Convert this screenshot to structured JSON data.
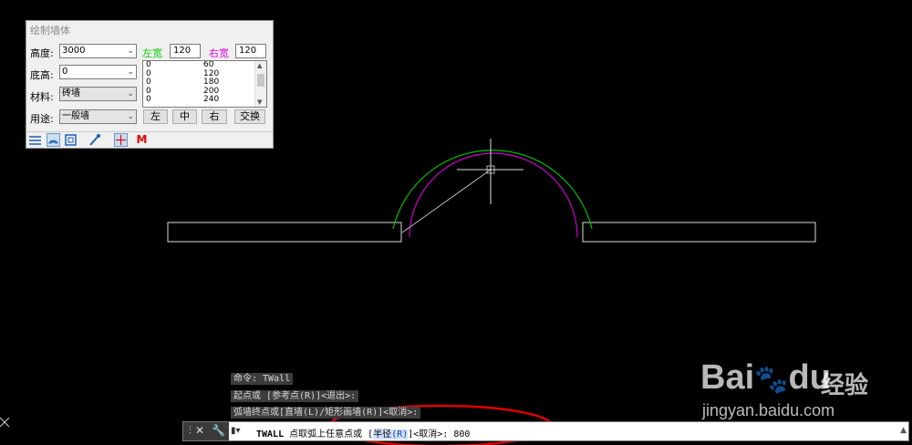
{
  "dialog": {
    "title": "绘制墙体",
    "height_label": "高度:",
    "height_value": "3000",
    "base_label": "底高:",
    "base_value": "0",
    "material_label": "材料:",
    "material_value": "砖墙",
    "usage_label": "用途:",
    "usage_value": "一般墙",
    "left_width_label": "左宽",
    "left_width_value": "120",
    "right_width_label": "右宽",
    "right_width_value": "120",
    "width_list": [
      {
        "left": "0",
        "right": "60"
      },
      {
        "left": "0",
        "right": "120"
      },
      {
        "left": "0",
        "right": "180"
      },
      {
        "left": "0",
        "right": "200"
      },
      {
        "left": "0",
        "right": "240"
      }
    ],
    "btn_left": "左",
    "btn_center": "中",
    "btn_right": "右",
    "btn_swap": "交换",
    "toolbar_m": "M",
    "colors": {
      "left_width": "#00cc00",
      "right_width": "#dd00dd",
      "m": "#e00000"
    }
  },
  "command": {
    "history": [
      "命令: TWall",
      "起点或 [参考点(R)]<退出>:",
      "弧墙终点或[直墙(L)/矩形画墙(R)]<取消>:"
    ],
    "prompt_cmd": "TWALL",
    "prompt_text": "点取弧上任意点或 [",
    "radius_label": "半径",
    "radius_key": "(R)",
    "prompt_tail": "]<取消>:",
    "input_value": "800"
  },
  "watermark": {
    "brand": "Bai",
    "brand_tail": "du",
    "site_cn": "经验",
    "url": "jingyan.baidu.com"
  },
  "colors": {
    "green_arc": "#00c000",
    "magenta_arc": "#cc00cc",
    "annotation": "#e00000"
  }
}
